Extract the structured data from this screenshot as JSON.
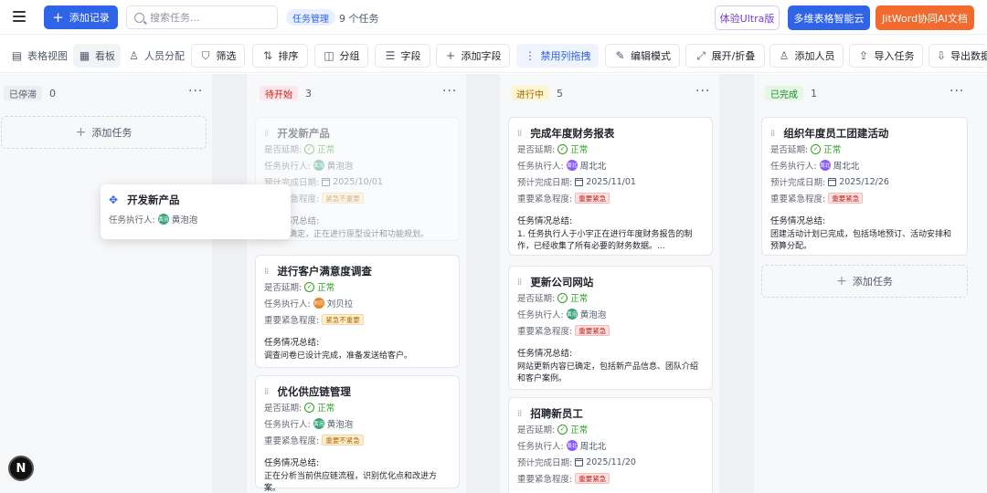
{
  "header": {
    "add_record": "添加记录",
    "search_placeholder": "搜索任务...",
    "project_badge": "任务管理",
    "task_count": "9 个任务",
    "ultra_btn": "体验Ultra版",
    "cloud_btn": "多维表格智能云",
    "jitword_btn": "JitWord协同AI文档"
  },
  "toolbar": {
    "table_view": "表格视图",
    "kanban": "看板",
    "people": "人员分配",
    "filter": "筛选",
    "sort": "排序",
    "group": "分组",
    "fields": "字段",
    "add_field": "添加字段",
    "disable_drag": "禁用列拖拽",
    "edit_mode": "编辑模式",
    "expand_collapse": "展开/折叠",
    "add_person": "添加人员",
    "import_task": "导入任务",
    "export_data": "导出数据"
  },
  "labels": {
    "delayed": "是否延期:",
    "assignee": "任务执行人:",
    "due": "预计完成日期:",
    "urgency": "重要紧急程度:",
    "summary": "任务情况总结:",
    "add_task": "添加任务"
  },
  "columns": [
    {
      "status": "已停滞",
      "count": "0",
      "pill_bg": "#eceef1",
      "pill_color": "#4e5969"
    },
    {
      "status": "待开始",
      "count": "3",
      "pill_bg": "#fde7ea",
      "pill_color": "#c4221b"
    },
    {
      "status": "进行中",
      "count": "5",
      "pill_bg": "#fff5d1",
      "pill_color": "#9a6b00"
    },
    {
      "status": "已完成",
      "count": "1",
      "pill_bg": "#e4f7e1",
      "pill_color": "#1e8a2e"
    }
  ],
  "cards": {
    "ghost": {
      "title": "开发新产品",
      "delayed": "正常",
      "assignee": "黄泡泡",
      "due": "2025/10/01",
      "urgency": "紧急不重要",
      "summary": "需求已确定，正在进行原型设计和功能规划。"
    },
    "customer_survey": {
      "title": "进行客户满意度调查",
      "delayed": "正常",
      "assignee": "刘贝拉",
      "urgency": "紧急不重要",
      "summary": "调查问卷已设计完成，准备发送给客户。"
    },
    "supply_chain": {
      "title": "优化供应链管理",
      "delayed": "正常",
      "assignee": "黄泡泡",
      "urgency": "重要不紧急",
      "summary": "正在分析当前供应链流程，识别优化点和改进方案。"
    },
    "annual_report": {
      "title": "完成年度财务报表",
      "delayed": "正常",
      "assignee": "周北北",
      "due": "2025/11/01",
      "urgency": "重要紧急",
      "summary": "1. 任务执行人于小宇正在进行年度财务报告的制作，已经收集了所有必要的财务数据。..."
    },
    "website": {
      "title": "更新公司网站",
      "delayed": "正常",
      "assignee": "黄泡泡",
      "urgency": "重要紧急",
      "summary": "网站更新内容已确定，包括新产品信息、团队介绍和客户案例。"
    },
    "hiring": {
      "title": "招聘新员工",
      "delayed": "正常",
      "assignee": "周北北",
      "due": "2025/11/20",
      "urgency": "重要紧急"
    },
    "team_building": {
      "title": "组织年度员工团建活动",
      "delayed": "正常",
      "assignee": "周北北",
      "due": "2025/12/26",
      "urgency": "重要紧急",
      "summary": "团建活动计划已完成，包括场地预订、活动安排和预算分配。"
    },
    "dragging": {
      "title": "开发新产品",
      "assignee": "黄泡泡"
    }
  },
  "avatars": {
    "huang": {
      "text": "黄泡",
      "color": "#3aa67a"
    },
    "liu": {
      "text": "刘贝",
      "color": "#e8832a"
    },
    "zhou": {
      "text": "周北",
      "color": "#8b5cf6"
    }
  },
  "fab": "N"
}
